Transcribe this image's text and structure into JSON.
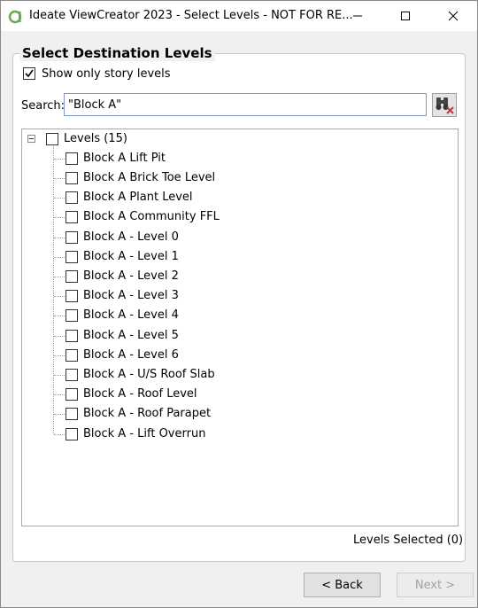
{
  "window": {
    "title": "Ideate ViewCreator 2023 - Select Levels - NOT FOR RE..."
  },
  "group": {
    "title": "Select Destination Levels"
  },
  "story_filter": {
    "label": "Show only story levels",
    "checked": true
  },
  "search": {
    "label": "Search:",
    "value": "\"Block A\""
  },
  "tree": {
    "root_label": "Levels (15)",
    "items": [
      "Block A Lift Pit",
      "Block A Brick Toe Level",
      "Block A Plant Level",
      "Block A Community FFL",
      "Block A - Level 0",
      "Block A - Level 1",
      "Block A - Level 2",
      "Block A - Level 3",
      "Block A - Level 4",
      "Block A - Level 5",
      "Block A - Level 6",
      "Block A - U/S Roof Slab",
      "Block A - Roof Level",
      "Block A - Roof Parapet",
      "Block A - Lift Overrun"
    ]
  },
  "status": {
    "levels_selected": "Levels Selected (0)"
  },
  "buttons": {
    "back": "< Back",
    "next": "Next >"
  }
}
